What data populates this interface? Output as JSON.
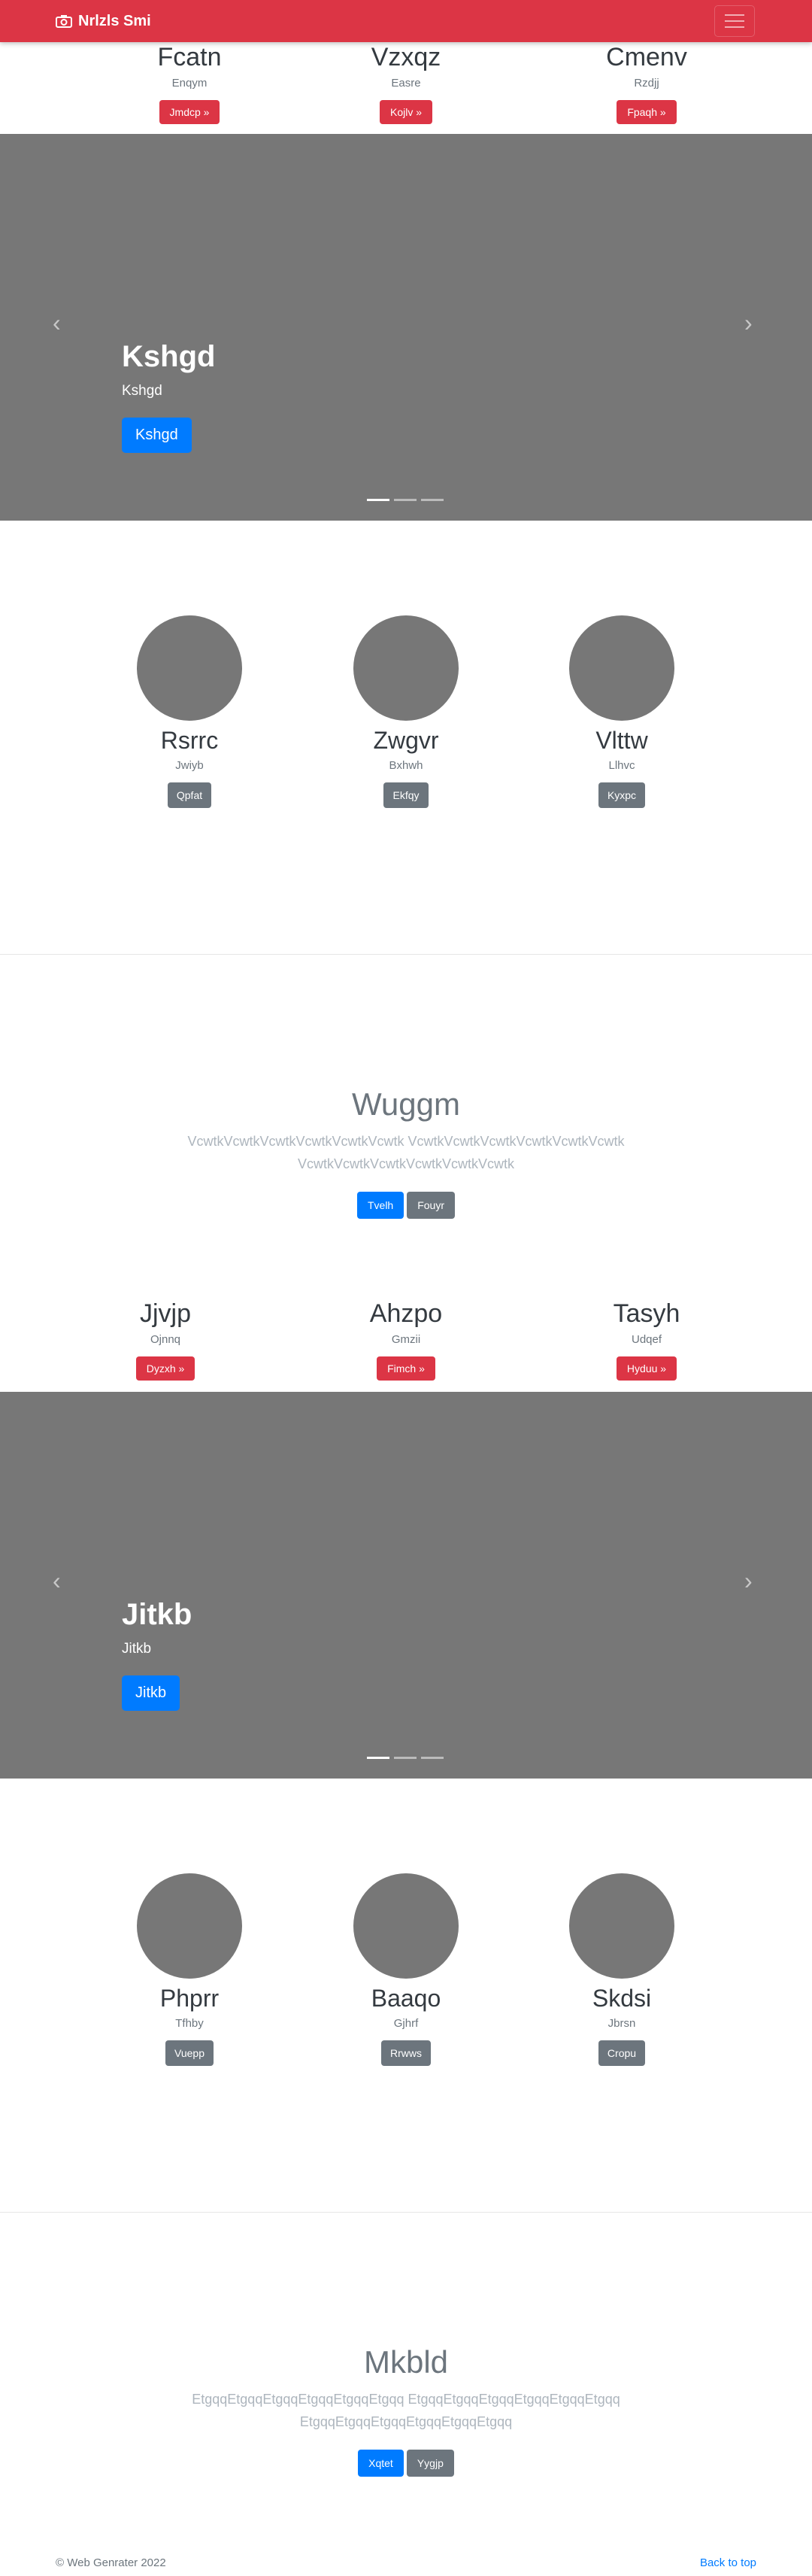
{
  "navbar": {
    "brand": "Nrlzls Smi",
    "brand_icon": "camera-icon"
  },
  "features_1": [
    {
      "title": "Fcatn",
      "subtitle": "Enqym",
      "button": "Jmdcp »"
    },
    {
      "title": "Vzxqz",
      "subtitle": "Easre",
      "button": "Kojlv »"
    },
    {
      "title": "Cmenv",
      "subtitle": "Rzdjj",
      "button": "Fpaqh »"
    }
  ],
  "carousel_1": {
    "title": "Kshgd",
    "subtitle": "Kshgd",
    "button": "Kshgd",
    "prev": "‹",
    "next": "›"
  },
  "marketing_1": [
    {
      "title": "Rsrrc",
      "subtitle": "Jwiyb",
      "button": "Qpfat"
    },
    {
      "title": "Zwgvr",
      "subtitle": "Bxhwh",
      "button": "Ekfqy"
    },
    {
      "title": "Vlttw",
      "subtitle": "Llhvc",
      "button": "Kyxpc"
    }
  ],
  "jumbotron_1": {
    "title": "Wuggm",
    "text": "VcwtkVcwtkVcwtkVcwtkVcwtkVcwtk VcwtkVcwtkVcwtkVcwtkVcwtkVcwtk VcwtkVcwtkVcwtkVcwtkVcwtkVcwtk",
    "primary": "Tvelh",
    "secondary": "Fouyr"
  },
  "features_2": [
    {
      "title": "Jjvjp",
      "subtitle": "Ojnnq",
      "button": "Dyzxh »"
    },
    {
      "title": "Ahzpo",
      "subtitle": "Gmzii",
      "button": "Fimch »"
    },
    {
      "title": "Tasyh",
      "subtitle": "Udqef",
      "button": "Hyduu »"
    }
  ],
  "carousel_2": {
    "title": "Jitkb",
    "subtitle": "Jitkb",
    "button": "Jitkb",
    "prev": "‹",
    "next": "›"
  },
  "marketing_2": [
    {
      "title": "Phprr",
      "subtitle": "Tfhby",
      "button": "Vuepp"
    },
    {
      "title": "Baaqo",
      "subtitle": "Gjhrf",
      "button": "Rrwws"
    },
    {
      "title": "Skdsi",
      "subtitle": "Jbrsn",
      "button": "Cropu"
    }
  ],
  "jumbotron_2": {
    "title": "Mkbld",
    "text": "EtgqqEtgqqEtgqqEtgqqEtgqqEtgqq EtgqqEtgqqEtgqqEtgqqEtgqqEtgqq EtgqqEtgqqEtgqqEtgqqEtgqqEtgqq",
    "primary": "Xqtet",
    "secondary": "Yygjp"
  },
  "footer": {
    "copyright": "© Web Genrater 2022",
    "back_to_top": "Back to top"
  },
  "colors": {
    "navbar": "#dc3545",
    "primary": "#007bff",
    "secondary": "#6c757d",
    "carousel_bg": "#777777"
  }
}
